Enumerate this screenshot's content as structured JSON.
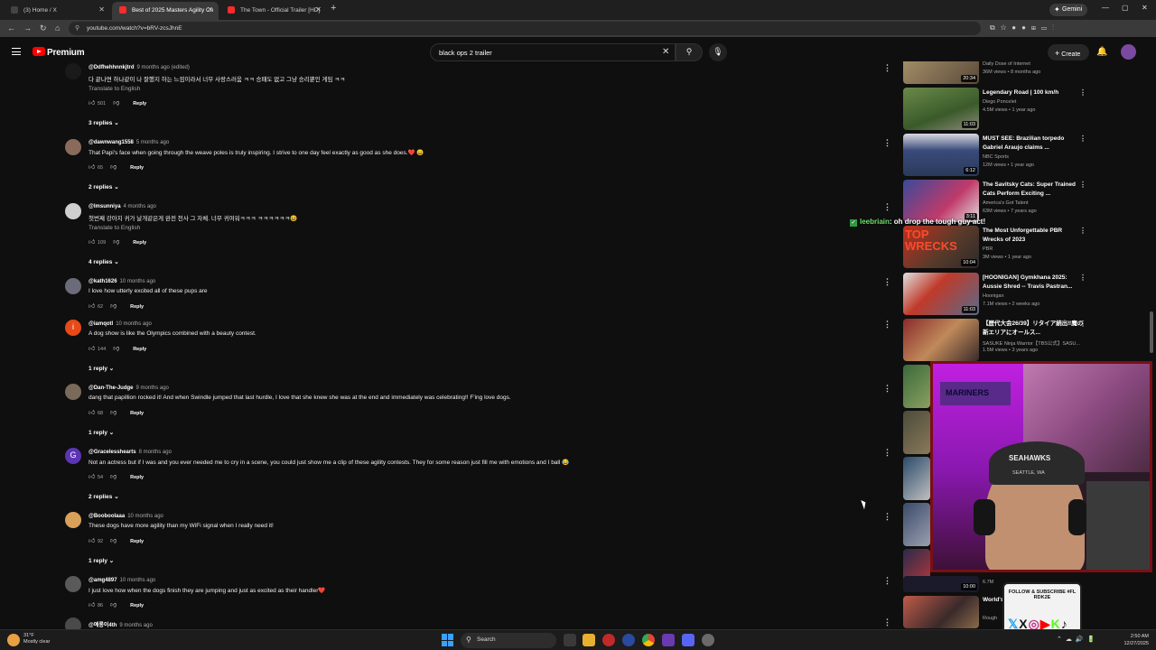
{
  "browser": {
    "tabs": [
      {
        "label": "(3) Home / X",
        "active": false,
        "favicon_color": "#333333"
      },
      {
        "label": "Best of 2025 Masters Agility Ch",
        "active": true,
        "favicon_color": "#ff0000"
      },
      {
        "label": "The Town - Official Trailer [HD]",
        "active": false,
        "favicon_color": "#ff0000"
      }
    ],
    "gemini_label": "Gemini",
    "url": "youtube.com/watch?v=bRV-zcsJhnE"
  },
  "youtube": {
    "brand": "Premium",
    "search_value": "black ops 2 trailer",
    "create_label": "Create"
  },
  "comments": [
    {
      "author": "@Ddfhehhnnkjtrd",
      "time": "9 months ago (edited)",
      "text": "다 끝나면 하나같이 나 잘했지 하는 느낌이라서 너무 사랑스러움 ㅋㅋ 승패도 없고 그냥 승리뿐인 게임 ㅋㅋ",
      "translate": "Translate to English",
      "likes": "501",
      "replies": "3 replies",
      "avatar_color": "#1a1a1a",
      "avatar_letter": ""
    },
    {
      "author": "@dawnwang1558",
      "time": "5 months ago",
      "text": "That Papi's face when going through the weave poles is truly inspiring. I strive to one day feel exactly as good as she does.❤️ 😄",
      "translate": "",
      "likes": "65",
      "replies": "2 replies",
      "avatar_color": "#8a6a5a",
      "avatar_letter": ""
    },
    {
      "author": "@lmsunniya",
      "time": "4 months ago",
      "text": "첫번째 강아지 귀가 날개같은게 완전 천사 그 자체. 너무 귀여워ㅋㅋㅋ ㅋㅋㅋㅋㅋㅋ😆",
      "translate": "Translate to English",
      "likes": "109",
      "replies": "4 replies",
      "avatar_color": "#cfcfcf",
      "avatar_letter": ""
    },
    {
      "author": "@kath1626",
      "time": "10 months ago",
      "text": "I love how utterly excited all of these pups are",
      "translate": "",
      "likes": "62",
      "replies": "",
      "avatar_color": "#6b6b7a",
      "avatar_letter": ""
    },
    {
      "author": "@iamqotl",
      "time": "10 months ago",
      "text": "A dog show is like the Olympics combined with a beauty contest.",
      "translate": "",
      "likes": "144",
      "replies": "1 reply",
      "avatar_color": "#e64a19",
      "avatar_letter": "i"
    },
    {
      "author": "@Dan-The-Judge",
      "time": "9 months ago",
      "text": "dang that papillion rocked it! And when Swindle jumped that last hurdle, I love that she knew she was at the end and immediately was celebrating!! F'ing love dogs.",
      "translate": "",
      "likes": "68",
      "replies": "1 reply",
      "avatar_color": "#7a6a5a",
      "avatar_letter": ""
    },
    {
      "author": "@Gracelesshearts",
      "time": "8 months ago",
      "text": "Not an actress but if I was and you ever needed me to cry in a scene, you could just show me a clip of these agility contests.  They for some reason just fill me with emotions and I ball 😂",
      "translate": "",
      "likes": "54",
      "replies": "2 replies",
      "avatar_color": "#5c35b5",
      "avatar_letter": "G"
    },
    {
      "author": "@Booboolaaa",
      "time": "10 months ago",
      "text": "These dogs have more agility than my WiFi signal when I really need it!",
      "translate": "",
      "likes": "92",
      "replies": "1 reply",
      "avatar_color": "#d9a05a",
      "avatar_letter": ""
    },
    {
      "author": "@amg4897",
      "time": "10 months ago",
      "text": "I just love how when the dogs finish  they are jumping and just as excited as their handler❤️",
      "translate": "",
      "likes": "86",
      "replies": "",
      "avatar_color": "#5a5a5a",
      "avatar_letter": ""
    },
    {
      "author": "@예롱이4th",
      "time": "9 months ago",
      "text": "",
      "translate": "",
      "likes": "",
      "replies": "",
      "avatar_color": "#4a4a4a",
      "avatar_letter": ""
    }
  ],
  "reply_label": "Reply",
  "sidebar": [
    {
      "title": "",
      "channel": "Daily Dose of Internet",
      "meta": "36M views • 8 months ago",
      "duration": "20:34",
      "thumb_color": "#8a7a5a"
    },
    {
      "title": "Legendary Road | 100 km/h",
      "channel": "Diego Poncelet",
      "meta": "4.5M views • 1 year ago",
      "duration": "11:03",
      "thumb_color": "#4e6a3a"
    },
    {
      "title": "MUST SEE: Brazilian torpedo Gabriel Araujo claims ...",
      "channel": "NBC Sports",
      "meta": "12M views • 1 year ago",
      "duration": "6:12",
      "thumb_color": "#3a4a6a"
    },
    {
      "title": "The Savitsky Cats: Super Trained Cats Perform Exciting ...",
      "channel": "America's Got Talent",
      "meta": "63M views • 7 years ago",
      "duration": "3:11",
      "thumb_color": "#a0304a"
    },
    {
      "title": "The Most Unforgettable PBR Wrecks of 2023",
      "channel": "PBR",
      "meta": "3M views • 1 year ago",
      "duration": "10:04",
      "thumb_color": "#5a3a2a"
    },
    {
      "title": "[HOONIGAN] Gymkhana 2025: Aussie Shred -- Travis Pastran...",
      "channel": "Hoonigan",
      "meta": "7.1M views • 2 weeks ago",
      "duration": "11:03",
      "thumb_color": "#b03a2a"
    },
    {
      "title": "【歴代大会26/39】リタイア続出‼魔の新エリアにオールス...",
      "channel": "SASUKE Ninja Warrior【TBS公式】SASU...",
      "meta": "1.5M views • 3 years ago",
      "duration": "",
      "thumb_color": "#7a2a2a"
    }
  ],
  "sidebar_bottom": {
    "meta": "6.7M",
    "duration": "10:00",
    "title2": "World's Brutali...",
    "channel2": "Rough"
  },
  "chat": {
    "user": "leebriain",
    "message": ": oh drop the tough guy act!"
  },
  "overlay": {
    "follow_text": "FOLLOW & SUBSCRIBE #FL RDK2E",
    "cap_text1": "SEAHAWKS",
    "cap_text2": "SEATTLE, WA",
    "banner_text": "MARINERS"
  },
  "taskbar": {
    "weather_temp": "31°F",
    "weather_desc": "Mostly clear",
    "search_label": "Search",
    "time": "2:50 AM",
    "date": "12/27/2025"
  }
}
